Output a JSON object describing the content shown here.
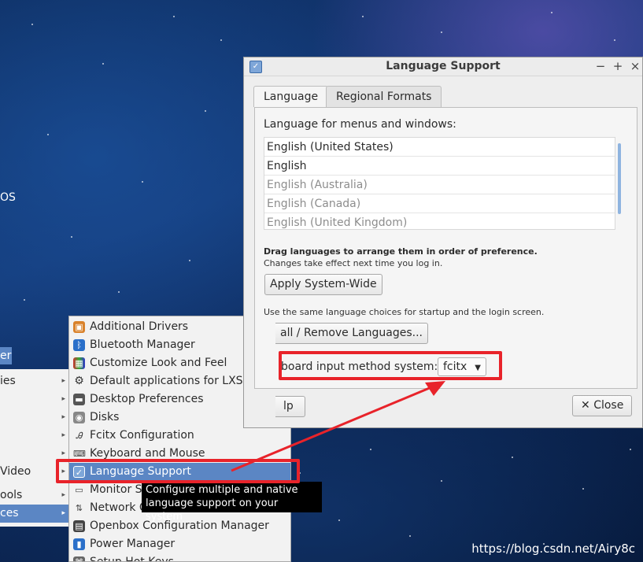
{
  "desktop": {
    "fragment_os": "OS",
    "fragment_er": "er",
    "watermark": "https://blog.csdn.net/Airy8c"
  },
  "left_menu": {
    "items": [
      {
        "label": "ies"
      },
      {
        "label": ""
      },
      {
        "label": ""
      },
      {
        "label": ""
      },
      {
        "label": ""
      },
      {
        "label": "Video"
      },
      {
        "label": "ools"
      },
      {
        "label": "ces"
      }
    ]
  },
  "submenu": {
    "items": [
      {
        "label": "Additional Drivers",
        "icon": "drivers-icon"
      },
      {
        "label": "Bluetooth Manager",
        "icon": "bluetooth-icon"
      },
      {
        "label": "Customize Look and Feel",
        "icon": "appearance-icon"
      },
      {
        "label": "Default applications for LXSession",
        "icon": "gear-icon"
      },
      {
        "label": "Desktop Preferences",
        "icon": "desktop-icon"
      },
      {
        "label": "Disks",
        "icon": "disk-icon"
      },
      {
        "label": "Fcitx Configuration",
        "icon": "fcitx-icon"
      },
      {
        "label": "Keyboard and Mouse",
        "icon": "keyboard-icon"
      },
      {
        "label": "Language Support",
        "icon": "language-icon"
      },
      {
        "label": "Monitor S",
        "icon": "monitor-icon"
      },
      {
        "label": "Network C",
        "icon": "network-icon"
      },
      {
        "label": "Openbox Configuration Manager",
        "icon": "openbox-icon"
      },
      {
        "label": "Power Manager",
        "icon": "power-icon"
      },
      {
        "label": "Setup Hot Keys",
        "icon": "hotkeys-icon"
      }
    ],
    "tooltip": "Configure multiple and native language support on your system"
  },
  "dialog": {
    "title": "Language Support",
    "window_buttons": {
      "minimize": "−",
      "maximize": "+",
      "close": "×"
    },
    "tabs": [
      {
        "label": "Language"
      },
      {
        "label": "Regional Formats"
      }
    ],
    "menus_label": "Language for menus and windows:",
    "languages": [
      "English (United States)",
      "English",
      "English (Australia)",
      "English (Canada)",
      "English (United Kingdom)"
    ],
    "drag_note": "Drag languages to arrange them in order of preference.",
    "change_note": "Changes take effect next time you log in.",
    "apply_button": "Apply System-Wide",
    "apply_note": "Use the same language choices for startup and the login screen.",
    "install_button": "all / Remove Languages...",
    "input_method_label": "board input method system:",
    "input_method_value": "fcitx",
    "help_button": "lp",
    "close_button": "Close"
  },
  "colors": {
    "highlight_red": "#e8232a",
    "menu_selection": "#5b86c4"
  }
}
